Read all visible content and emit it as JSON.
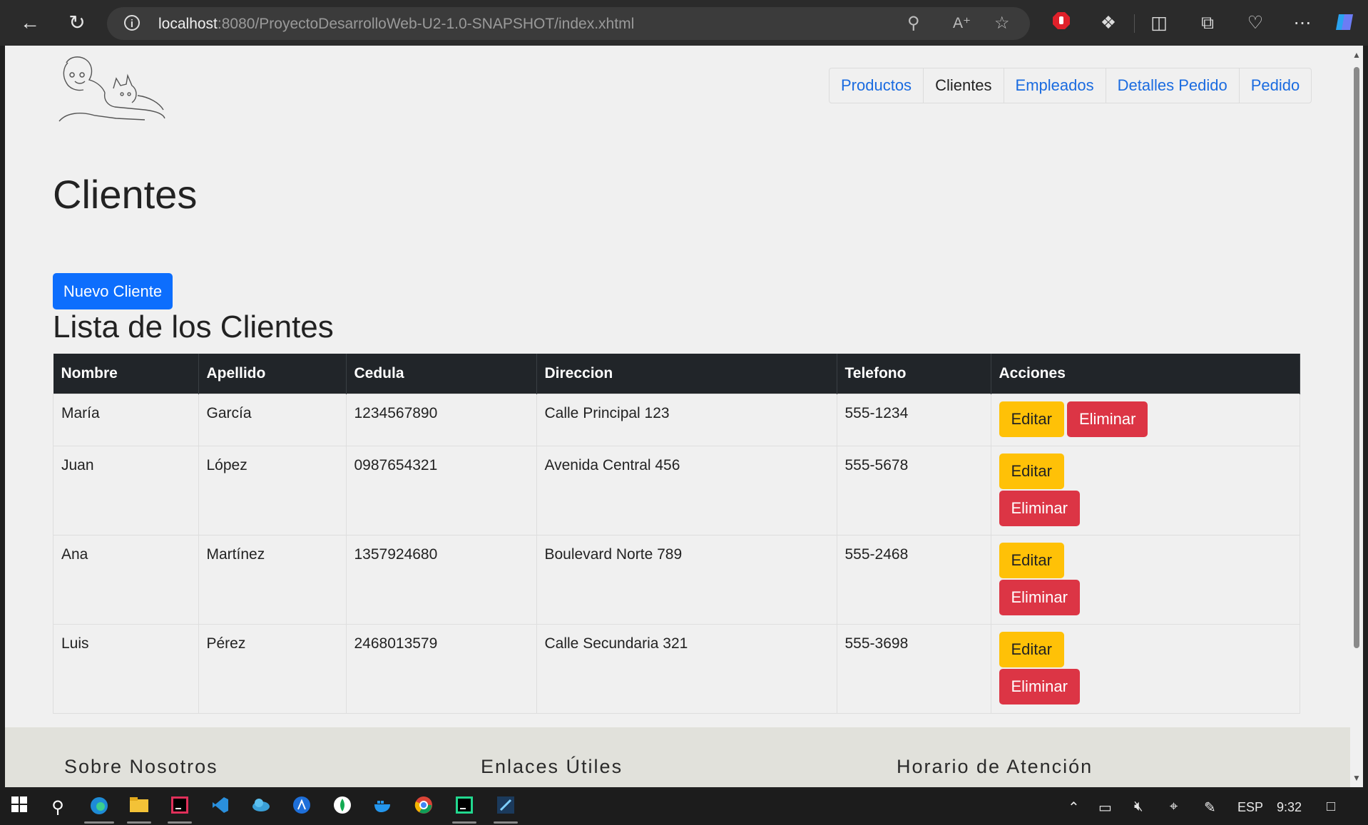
{
  "browser": {
    "url_host": "localhost",
    "url_rest": ":8080/ProyectoDesarrolloWeb-U2-1.0-SNAPSHOT/index.xhtml"
  },
  "nav": {
    "items": [
      {
        "label": "Productos",
        "active": false
      },
      {
        "label": "Clientes",
        "active": true
      },
      {
        "label": "Empleados",
        "active": false
      },
      {
        "label": "Detalles Pedido",
        "active": false
      },
      {
        "label": "Pedido",
        "active": false
      }
    ]
  },
  "main": {
    "page_title": "Clientes",
    "new_button": "Nuevo Cliente",
    "list_title": "Lista de los Clientes"
  },
  "table": {
    "headers": [
      "Nombre",
      "Apellido",
      "Cedula",
      "Direccion",
      "Telefono",
      "Acciones"
    ],
    "edit_label": "Editar",
    "delete_label": "Eliminar",
    "rows": [
      {
        "nombre": "María",
        "apellido": "García",
        "cedula": "1234567890",
        "direccion": "Calle Principal 123",
        "telefono": "555-1234"
      },
      {
        "nombre": "Juan",
        "apellido": "López",
        "cedula": "0987654321",
        "direccion": "Avenida Central 456",
        "telefono": "555-5678"
      },
      {
        "nombre": "Ana",
        "apellido": "Martínez",
        "cedula": "1357924680",
        "direccion": "Boulevard Norte 789",
        "telefono": "555-2468"
      },
      {
        "nombre": "Luis",
        "apellido": "Pérez",
        "cedula": "2468013579",
        "direccion": "Calle Secundaria 321",
        "telefono": "555-3698"
      }
    ]
  },
  "footer": {
    "col1": "Sobre Nosotros",
    "col2": "Enlaces Útiles",
    "col3": "Horario de Atención"
  },
  "taskbar": {
    "lang": "ESP",
    "time": "9:32"
  },
  "colors": {
    "primary": "#0d6efd",
    "warning": "#ffc107",
    "danger": "#dc3545",
    "table_header": "#212529"
  }
}
